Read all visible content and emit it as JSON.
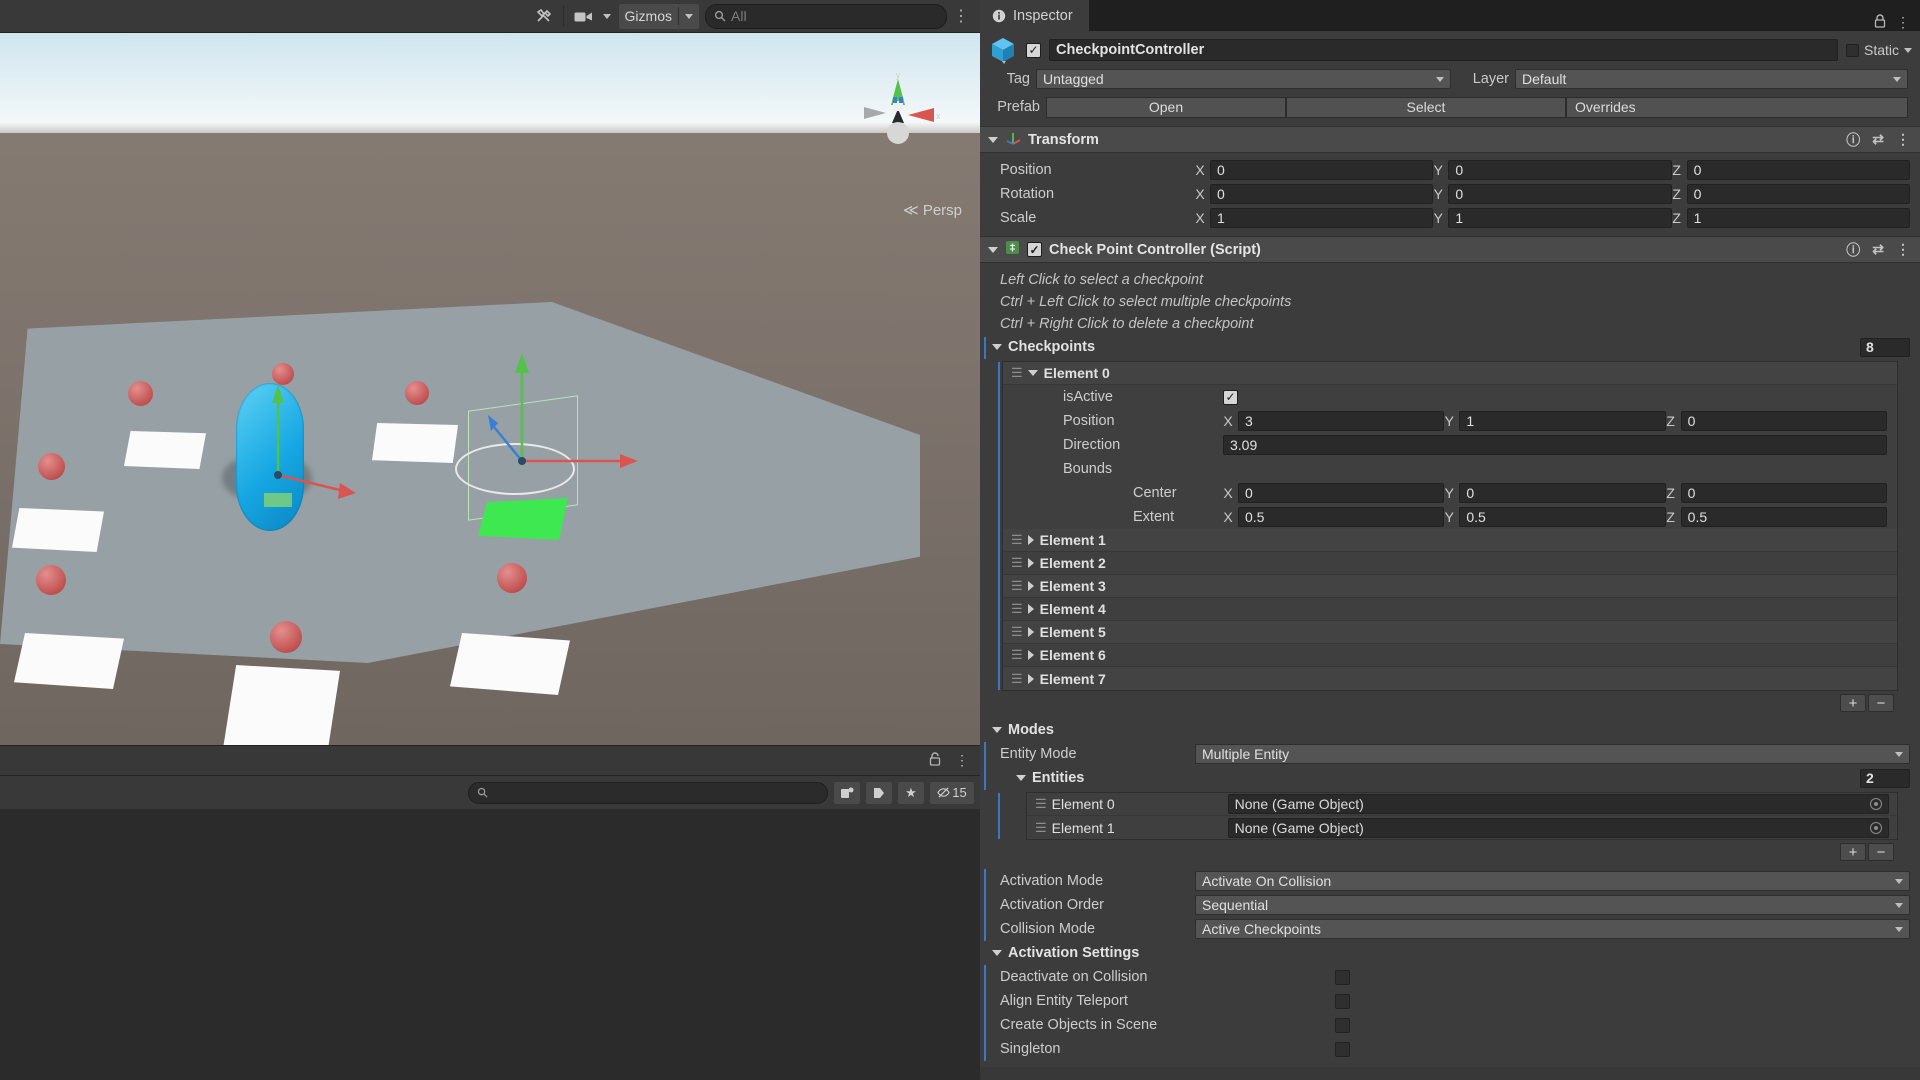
{
  "scene": {
    "toolbar": {
      "tools_icon": "tools-icon",
      "camera_icon": "camera-icon",
      "gizmos_label": "Gizmos",
      "search_placeholder": "All",
      "search_icon": "search-icon",
      "kebab_icon": "kebab-menu-icon"
    },
    "persp_label": "Persp",
    "axis_labels": {
      "x": "x",
      "y": "y",
      "z": "z"
    },
    "bottom": {
      "lock_icon": "lock-icon",
      "kebab_icon": "kebab-menu-icon"
    }
  },
  "project": {
    "search_placeholder": "",
    "search_icon": "search-icon",
    "icons": [
      "new-asset-icon",
      "label-icon",
      "favorite-icon",
      "hidden-count-icon"
    ],
    "hidden_count": "15"
  },
  "inspector": {
    "tab_label": "Inspector",
    "tab_icon": "info-icon",
    "lock_icon": "lock-icon",
    "kebab_icon": "kebab-menu-icon",
    "object": {
      "icon": "prefab-cube-icon",
      "enabled": true,
      "name": "CheckpointController",
      "static_label": "Static",
      "tag_label": "Tag",
      "tag_value": "Untagged",
      "layer_label": "Layer",
      "layer_value": "Default",
      "prefab_label": "Prefab",
      "prefab_open": "Open",
      "prefab_select": "Select",
      "prefab_overrides": "Overrides"
    },
    "transform": {
      "title": "Transform",
      "icon": "transform-axes-icon",
      "help_icon": "help-icon",
      "preset_icon": "preset-icon",
      "kebab_icon": "kebab-menu-icon",
      "rows": [
        {
          "label": "Position",
          "x": "0",
          "y": "0",
          "z": "0"
        },
        {
          "label": "Rotation",
          "x": "0",
          "y": "0",
          "z": "0"
        },
        {
          "label": "Scale",
          "x": "1",
          "y": "1",
          "z": "1"
        }
      ],
      "axes": [
        "X",
        "Y",
        "Z"
      ]
    },
    "script_component": {
      "title": "Check Point Controller (Script)",
      "icon": "script-icon",
      "enabled": true,
      "help_icon": "help-icon",
      "preset_icon": "preset-icon",
      "kebab_icon": "kebab-menu-icon",
      "hints": [
        "Left Click to select a checkpoint",
        "Ctrl + Left Click to select multiple checkpoints",
        "Ctrl + Right Click to delete a checkpoint"
      ],
      "checkpoints": {
        "label": "Checkpoints",
        "size": "8",
        "element0": {
          "label": "Element 0",
          "isActive_label": "isActive",
          "isActive_value": true,
          "position_label": "Position",
          "position": {
            "x": "3",
            "y": "1",
            "z": "0"
          },
          "direction_label": "Direction",
          "direction_value": "3.09",
          "bounds_label": "Bounds",
          "center_label": "Center",
          "center": {
            "x": "0",
            "y": "0",
            "z": "0"
          },
          "extent_label": "Extent",
          "extent": {
            "x": "0.5",
            "y": "0.5",
            "z": "0.5"
          }
        },
        "collapsed_elements": [
          "Element 1",
          "Element 2",
          "Element 3",
          "Element 4",
          "Element 5",
          "Element 6",
          "Element 7"
        ],
        "add_label": "+",
        "remove_label": "−"
      },
      "modes": {
        "label": "Modes",
        "entity_mode_label": "Entity Mode",
        "entity_mode_value": "Multiple Entity",
        "entities_label": "Entities",
        "entities_size": "2",
        "entities": [
          {
            "label": "Element 0",
            "value": "None (Game Object)"
          },
          {
            "label": "Element 1",
            "value": "None (Game Object)"
          }
        ],
        "add_label": "+",
        "remove_label": "−"
      },
      "activation_mode_label": "Activation Mode",
      "activation_mode_value": "Activate On Collision",
      "activation_order_label": "Activation Order",
      "activation_order_value": "Sequential",
      "collision_mode_label": "Collision Mode",
      "collision_mode_value": "Active Checkpoints",
      "activation_settings": {
        "label": "Activation Settings",
        "items": [
          {
            "label": "Deactivate on Collision",
            "checked": false
          },
          {
            "label": "Align Entity Teleport",
            "checked": false
          },
          {
            "label": "Create Objects in Scene",
            "checked": false
          },
          {
            "label": "Singleton",
            "checked": false
          }
        ]
      }
    }
  },
  "colors": {
    "accent_blue": "#3a79c2",
    "panel_bg": "#383838",
    "header_bg": "#4a4a4a",
    "field_bg": "#2a2a2a",
    "axis_x": "#d9554f",
    "axis_y": "#52c24b",
    "axis_z": "#3b7fd4"
  }
}
